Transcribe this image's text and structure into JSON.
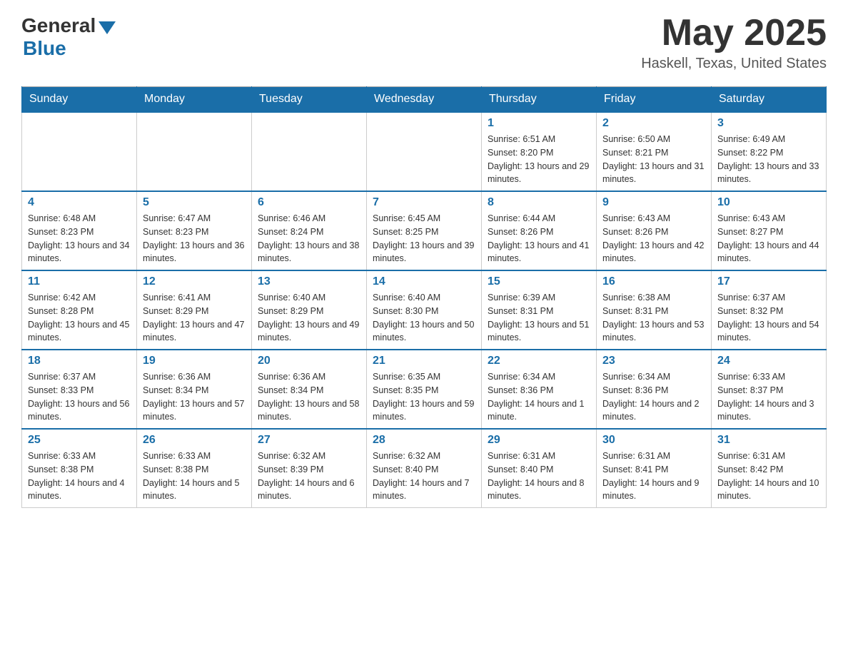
{
  "header": {
    "logo_general": "General",
    "logo_blue": "Blue",
    "month_title": "May 2025",
    "location": "Haskell, Texas, United States"
  },
  "days_of_week": [
    "Sunday",
    "Monday",
    "Tuesday",
    "Wednesday",
    "Thursday",
    "Friday",
    "Saturday"
  ],
  "weeks": [
    [
      {
        "day": "",
        "info": ""
      },
      {
        "day": "",
        "info": ""
      },
      {
        "day": "",
        "info": ""
      },
      {
        "day": "",
        "info": ""
      },
      {
        "day": "1",
        "info": "Sunrise: 6:51 AM\nSunset: 8:20 PM\nDaylight: 13 hours and 29 minutes."
      },
      {
        "day": "2",
        "info": "Sunrise: 6:50 AM\nSunset: 8:21 PM\nDaylight: 13 hours and 31 minutes."
      },
      {
        "day": "3",
        "info": "Sunrise: 6:49 AM\nSunset: 8:22 PM\nDaylight: 13 hours and 33 minutes."
      }
    ],
    [
      {
        "day": "4",
        "info": "Sunrise: 6:48 AM\nSunset: 8:23 PM\nDaylight: 13 hours and 34 minutes."
      },
      {
        "day": "5",
        "info": "Sunrise: 6:47 AM\nSunset: 8:23 PM\nDaylight: 13 hours and 36 minutes."
      },
      {
        "day": "6",
        "info": "Sunrise: 6:46 AM\nSunset: 8:24 PM\nDaylight: 13 hours and 38 minutes."
      },
      {
        "day": "7",
        "info": "Sunrise: 6:45 AM\nSunset: 8:25 PM\nDaylight: 13 hours and 39 minutes."
      },
      {
        "day": "8",
        "info": "Sunrise: 6:44 AM\nSunset: 8:26 PM\nDaylight: 13 hours and 41 minutes."
      },
      {
        "day": "9",
        "info": "Sunrise: 6:43 AM\nSunset: 8:26 PM\nDaylight: 13 hours and 42 minutes."
      },
      {
        "day": "10",
        "info": "Sunrise: 6:43 AM\nSunset: 8:27 PM\nDaylight: 13 hours and 44 minutes."
      }
    ],
    [
      {
        "day": "11",
        "info": "Sunrise: 6:42 AM\nSunset: 8:28 PM\nDaylight: 13 hours and 45 minutes."
      },
      {
        "day": "12",
        "info": "Sunrise: 6:41 AM\nSunset: 8:29 PM\nDaylight: 13 hours and 47 minutes."
      },
      {
        "day": "13",
        "info": "Sunrise: 6:40 AM\nSunset: 8:29 PM\nDaylight: 13 hours and 49 minutes."
      },
      {
        "day": "14",
        "info": "Sunrise: 6:40 AM\nSunset: 8:30 PM\nDaylight: 13 hours and 50 minutes."
      },
      {
        "day": "15",
        "info": "Sunrise: 6:39 AM\nSunset: 8:31 PM\nDaylight: 13 hours and 51 minutes."
      },
      {
        "day": "16",
        "info": "Sunrise: 6:38 AM\nSunset: 8:31 PM\nDaylight: 13 hours and 53 minutes."
      },
      {
        "day": "17",
        "info": "Sunrise: 6:37 AM\nSunset: 8:32 PM\nDaylight: 13 hours and 54 minutes."
      }
    ],
    [
      {
        "day": "18",
        "info": "Sunrise: 6:37 AM\nSunset: 8:33 PM\nDaylight: 13 hours and 56 minutes."
      },
      {
        "day": "19",
        "info": "Sunrise: 6:36 AM\nSunset: 8:34 PM\nDaylight: 13 hours and 57 minutes."
      },
      {
        "day": "20",
        "info": "Sunrise: 6:36 AM\nSunset: 8:34 PM\nDaylight: 13 hours and 58 minutes."
      },
      {
        "day": "21",
        "info": "Sunrise: 6:35 AM\nSunset: 8:35 PM\nDaylight: 13 hours and 59 minutes."
      },
      {
        "day": "22",
        "info": "Sunrise: 6:34 AM\nSunset: 8:36 PM\nDaylight: 14 hours and 1 minute."
      },
      {
        "day": "23",
        "info": "Sunrise: 6:34 AM\nSunset: 8:36 PM\nDaylight: 14 hours and 2 minutes."
      },
      {
        "day": "24",
        "info": "Sunrise: 6:33 AM\nSunset: 8:37 PM\nDaylight: 14 hours and 3 minutes."
      }
    ],
    [
      {
        "day": "25",
        "info": "Sunrise: 6:33 AM\nSunset: 8:38 PM\nDaylight: 14 hours and 4 minutes."
      },
      {
        "day": "26",
        "info": "Sunrise: 6:33 AM\nSunset: 8:38 PM\nDaylight: 14 hours and 5 minutes."
      },
      {
        "day": "27",
        "info": "Sunrise: 6:32 AM\nSunset: 8:39 PM\nDaylight: 14 hours and 6 minutes."
      },
      {
        "day": "28",
        "info": "Sunrise: 6:32 AM\nSunset: 8:40 PM\nDaylight: 14 hours and 7 minutes."
      },
      {
        "day": "29",
        "info": "Sunrise: 6:31 AM\nSunset: 8:40 PM\nDaylight: 14 hours and 8 minutes."
      },
      {
        "day": "30",
        "info": "Sunrise: 6:31 AM\nSunset: 8:41 PM\nDaylight: 14 hours and 9 minutes."
      },
      {
        "day": "31",
        "info": "Sunrise: 6:31 AM\nSunset: 8:42 PM\nDaylight: 14 hours and 10 minutes."
      }
    ]
  ]
}
